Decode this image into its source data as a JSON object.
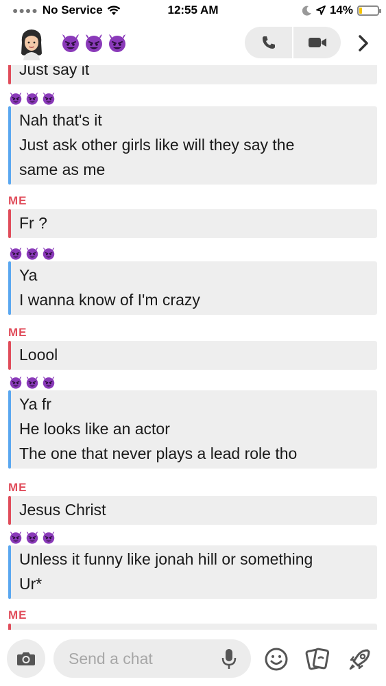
{
  "status_bar": {
    "carrier": "No Service",
    "time": "12:55 AM",
    "battery": "14%",
    "battery_level": 0.14
  },
  "header": {
    "contact_emojis": [
      "devil",
      "devil",
      "devil"
    ]
  },
  "messages": [
    {
      "sender": "me",
      "lines": [
        "Just say it"
      ]
    },
    {
      "sender": "them",
      "lines": [
        "Nah that's it",
        "Just ask other girls like will they say the",
        "same as me"
      ]
    },
    {
      "sender": "me",
      "sender_label": "ME",
      "lines": [
        "Fr ?"
      ]
    },
    {
      "sender": "them",
      "lines": [
        "Ya",
        "I wanna know of I'm crazy"
      ]
    },
    {
      "sender": "me",
      "sender_label": "ME",
      "lines": [
        "Loool"
      ]
    },
    {
      "sender": "them",
      "lines": [
        "Ya fr",
        "He looks like an actor",
        "The one that never plays a lead role tho"
      ]
    },
    {
      "sender": "me",
      "sender_label": "ME",
      "lines": [
        "Jesus Christ"
      ]
    },
    {
      "sender": "them",
      "lines": [
        "Unless it funny like jonah hill or something",
        "Ur*"
      ]
    },
    {
      "sender": "me",
      "sender_label": "ME",
      "lines": []
    }
  ],
  "input": {
    "placeholder": "Send a chat"
  },
  "colors": {
    "me_accent": "#e04c5a",
    "them_accent": "#5aa7f0",
    "bubble_bg": "#eeeeee",
    "emoji_purple": "#8a3ab9"
  }
}
